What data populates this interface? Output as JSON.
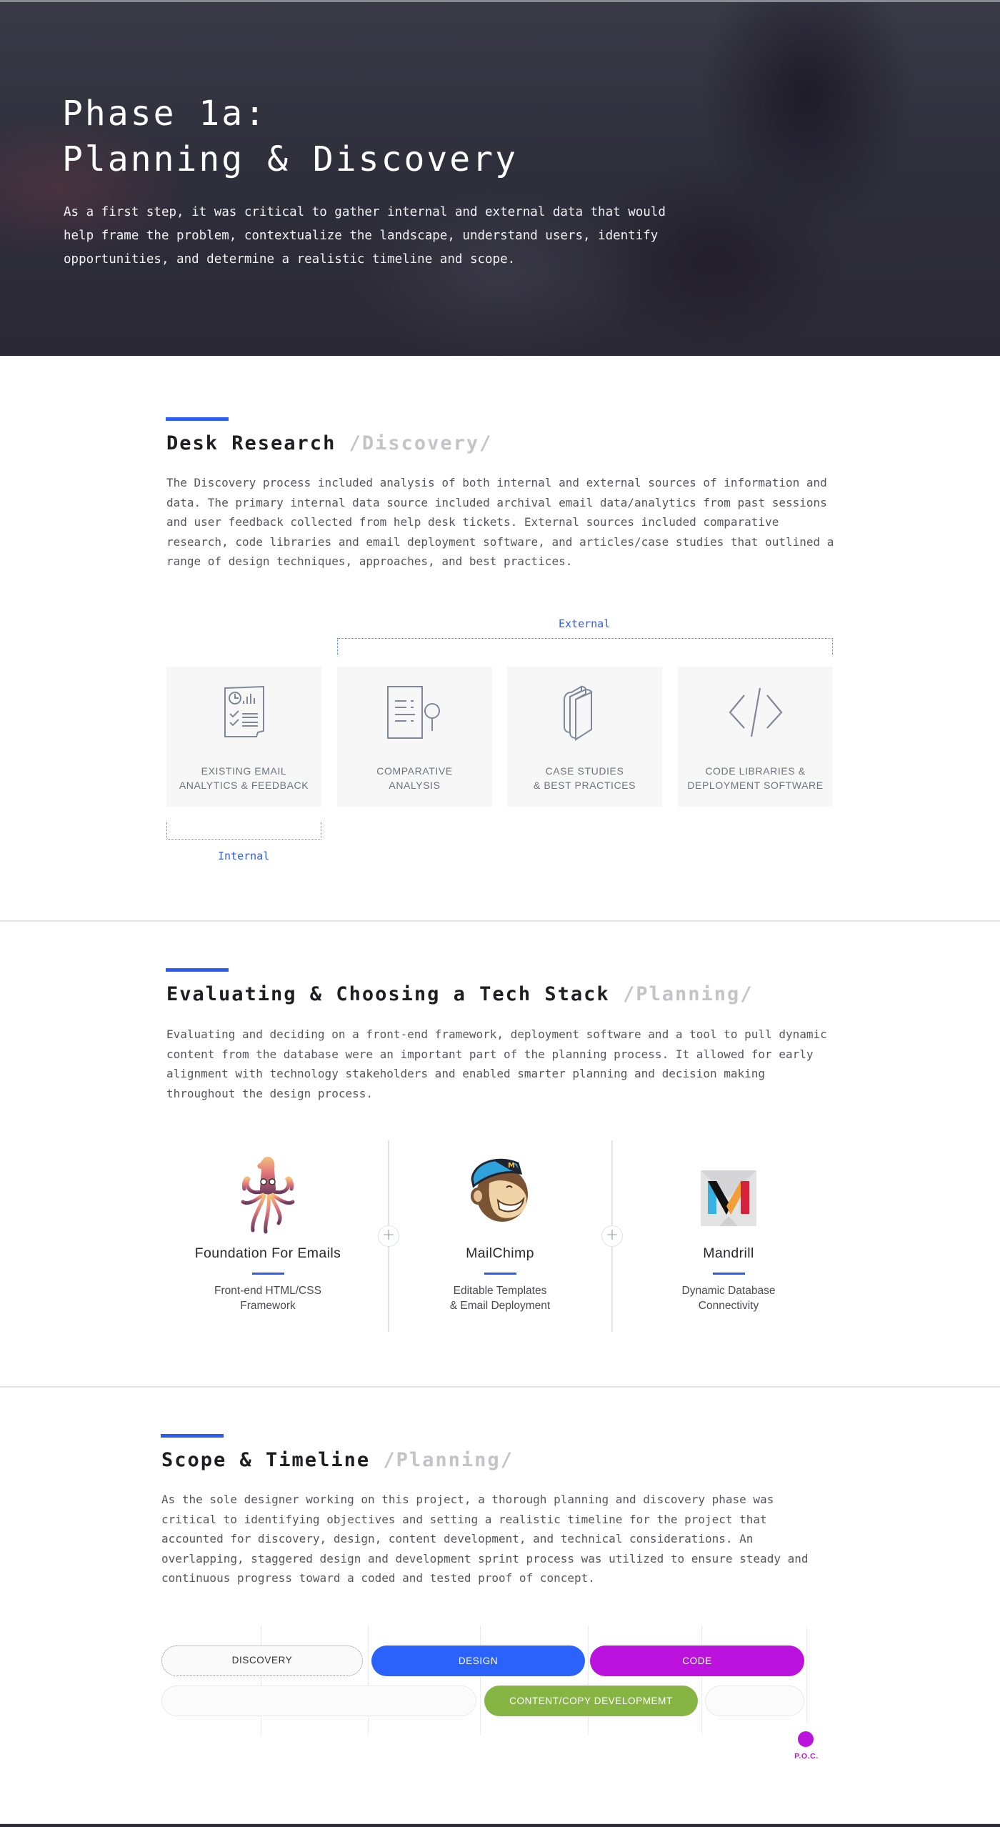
{
  "hero": {
    "title_line1": "Phase 1a:",
    "title_line2": "Planning & Discovery",
    "text": "As a first step, it was critical to gather internal and external data that would help frame the problem, contextualize the landscape, understand users, identify opportunities, and determine a realistic timeline and scope."
  },
  "desk_research": {
    "title": "Desk Research",
    "tag": "/Discovery/",
    "text": "The Discovery process included analysis of both internal and external sources of information and data. The primary internal data source included archival email data/analytics from past sessions and user feedback collected from help desk tickets. External sources included comparative research, code libraries and email deployment software, and articles/case studies that outlined a range of design techniques, approaches, and best practices.",
    "external_label": "External",
    "internal_label": "Internal",
    "cards": [
      {
        "icon": "report-checklist-icon",
        "label": "EXISTING EMAIL\nANALYTICS & FEEDBACK"
      },
      {
        "icon": "document-magnifier-icon",
        "label": "COMPARATIVE\nANALYSIS"
      },
      {
        "icon": "books-icon",
        "label": "CASE STUDIES\n& BEST PRACTICES"
      },
      {
        "icon": "code-icon",
        "label": "CODE LIBRARIES &\nDEPLOYMENT SOFTWARE"
      }
    ]
  },
  "tech_stack": {
    "title": "Evaluating & Choosing a Tech Stack",
    "tag": "/Planning/",
    "text": "Evaluating and deciding on a front-end framework, deployment software and a tool to pull dynamic content from the database were an important part of the planning process. It allowed for early alignment with technology stakeholders and enabled smarter planning and decision making throughout the design process.",
    "tools": [
      {
        "logo": "foundation-squid-logo",
        "name": "Foundation For Emails",
        "desc": "Front-end HTML/CSS\nFramework"
      },
      {
        "logo": "mailchimp-logo",
        "name": "MailChimp",
        "desc": "Editable Templates\n& Email Deployment"
      },
      {
        "logo": "mandrill-logo",
        "name": "Mandrill",
        "desc": "Dynamic Database\nConnectivity"
      }
    ],
    "plus_symbol": "+"
  },
  "scope": {
    "title": "Scope & Timeline",
    "tag": "/Planning/",
    "text": "As the sole designer working on this project, a thorough planning and discovery phase was critical to identifying objectives and setting a realistic timeline for the project that accounted for discovery, design, content development, and technical considerations. An overlapping, staggered design and development sprint process was utilized to ensure steady and continuous progress toward a coded and tested proof of concept.",
    "timeline": {
      "row1": [
        {
          "label": "DISCOVERY",
          "style": "outlined"
        },
        {
          "label": "DESIGN",
          "color": "#2b62fb"
        },
        {
          "label": "CODE",
          "color": "#bc12dd"
        }
      ],
      "row2": [
        {
          "label": "",
          "style": "empty"
        },
        {
          "label": "CONTENT/COPY DEVELOPMEMT",
          "color": "#86b543"
        },
        {
          "label": "",
          "style": "empty"
        }
      ],
      "milestone": {
        "label": "P.O.C.",
        "color": "#bc12dd"
      }
    }
  },
  "colors": {
    "accent": "#2b5cf6",
    "design": "#2b62fb",
    "code": "#bc12dd",
    "content": "#86b543"
  }
}
